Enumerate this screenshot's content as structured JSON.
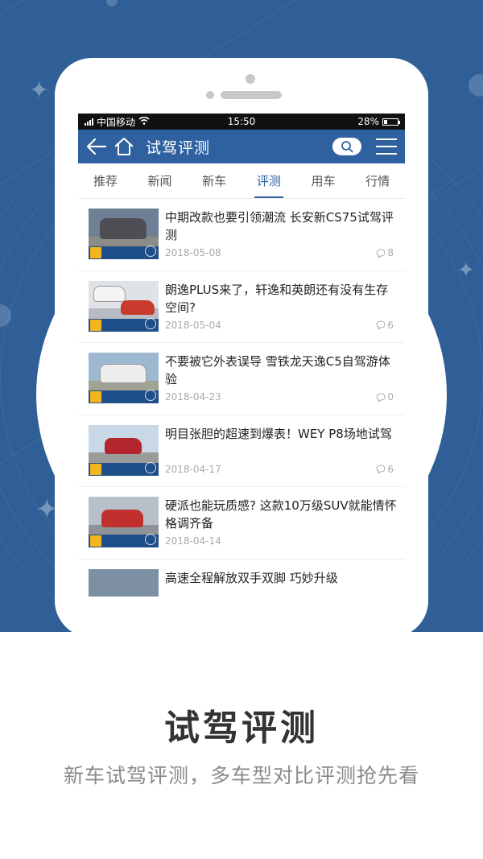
{
  "status_bar": {
    "carrier": "中国移动",
    "time": "15:50",
    "battery_percent": "28%",
    "battery_level": 0.28
  },
  "nav": {
    "title": "试驾评测",
    "back_icon": "arrow-left-icon",
    "home_icon": "home-icon",
    "search_icon": "search-icon",
    "menu_icon": "menu-icon"
  },
  "tabs": [
    {
      "label": "推荐",
      "active": false
    },
    {
      "label": "新闻",
      "active": false
    },
    {
      "label": "新车",
      "active": false
    },
    {
      "label": "评测",
      "active": true
    },
    {
      "label": "用车",
      "active": false
    },
    {
      "label": "行情",
      "active": false
    }
  ],
  "articles": [
    {
      "title": "中期改款也要引领潮流 长安新CS75试驾评测",
      "date": "2018-05-08",
      "comments": "8"
    },
    {
      "title": "朗逸PLUS来了，轩逸和英朗还有没有生存空间?",
      "date": "2018-05-04",
      "comments": "6"
    },
    {
      "title": "不要被它外表误导 雪铁龙天逸C5自驾游体验",
      "date": "2018-04-23",
      "comments": "0"
    },
    {
      "title": "明目张胆的超速到爆表！WEY P8场地试驾",
      "date": "2018-04-17",
      "comments": "6"
    },
    {
      "title": "硬派也能玩质感? 这款10万级SUV就能情怀格调齐备",
      "date": "2018-04-14",
      "comments": ""
    },
    {
      "title": "高速全程解放双手双脚 巧妙升级",
      "date": "",
      "comments": ""
    }
  ],
  "caption": {
    "title": "试驾评测",
    "subtitle": "新车试驾评测，多车型对比评测抢先看"
  },
  "colors": {
    "hero_background": "#2f5f96",
    "nav_background": "#2f61a0",
    "accent": "#2f61a0"
  }
}
